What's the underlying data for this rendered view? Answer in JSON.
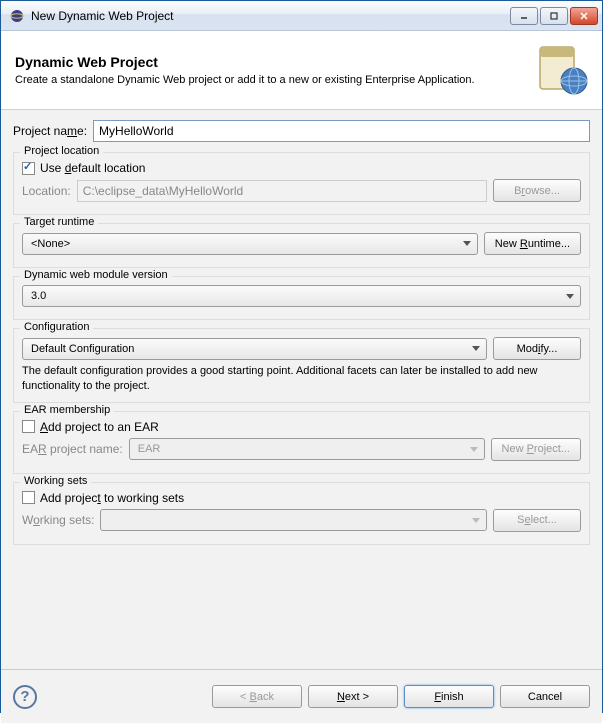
{
  "window": {
    "title": "New Dynamic Web Project"
  },
  "banner": {
    "heading": "Dynamic Web Project",
    "description": "Create a standalone Dynamic Web project or add it to a new or existing Enterprise Application."
  },
  "project_name": {
    "label": "Project name:",
    "value": "MyHelloWorld"
  },
  "project_location": {
    "group_title": "Project location",
    "use_default_label": "Use default location",
    "use_default_checked": true,
    "location_label": "Location:",
    "location_value": "C:\\eclipse_data\\MyHelloWorld",
    "browse_label": "Browse..."
  },
  "target_runtime": {
    "group_title": "Target runtime",
    "selected": "<None>",
    "new_runtime_label": "New Runtime..."
  },
  "module_version": {
    "group_title": "Dynamic web module version",
    "selected": "3.0"
  },
  "configuration": {
    "group_title": "Configuration",
    "selected": "Default Configuration",
    "modify_label": "Modify...",
    "description": "The default configuration provides a good starting point. Additional facets can later be installed to add new functionality to the project."
  },
  "ear": {
    "group_title": "EAR membership",
    "add_label": "Add project to an EAR",
    "add_checked": false,
    "project_label": "EAR project name:",
    "project_value": "EAR",
    "new_project_label": "New Project..."
  },
  "working_sets": {
    "group_title": "Working sets",
    "add_label": "Add project to working sets",
    "add_checked": false,
    "label": "Working sets:",
    "select_label": "Select..."
  },
  "buttons": {
    "back": "< Back",
    "next": "Next >",
    "finish": "Finish",
    "cancel": "Cancel"
  }
}
